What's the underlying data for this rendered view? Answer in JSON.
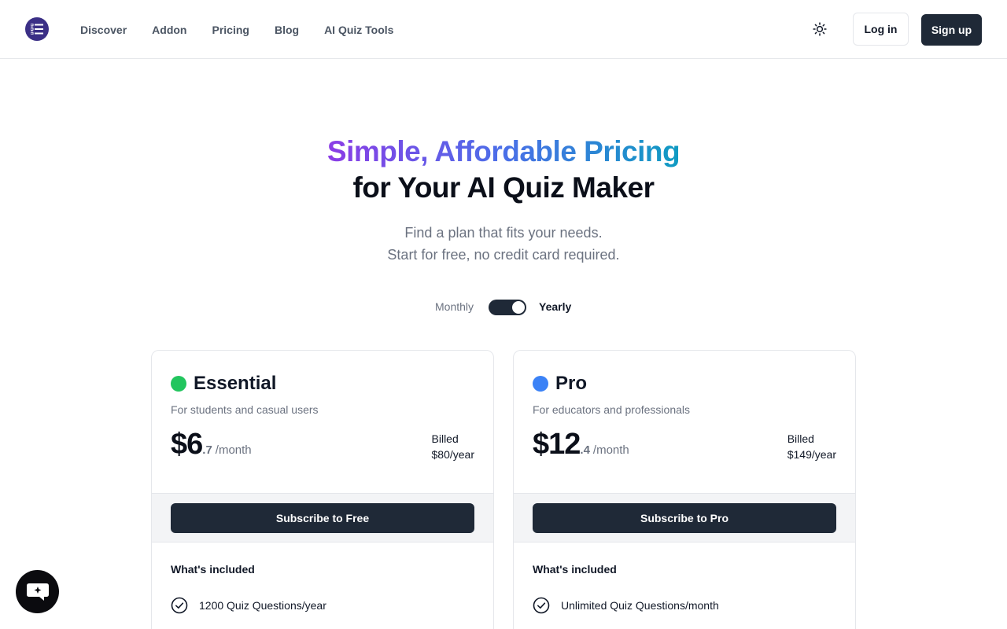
{
  "header": {
    "nav": [
      "Discover",
      "Addon",
      "Pricing",
      "Blog",
      "AI Quiz Tools"
    ],
    "login_label": "Log in",
    "signup_label": "Sign up",
    "theme_icon": "sun-icon",
    "logo_icon": "list-icon"
  },
  "hero": {
    "title_gradient": "Simple, Affordable Pricing",
    "title_dark": "for Your AI Quiz Maker",
    "subtitle_line1": "Find a plan that fits your needs.",
    "subtitle_line2": "Start for free, no credit card required."
  },
  "billing": {
    "monthly_label": "Monthly",
    "yearly_label": "Yearly",
    "selected": "Yearly"
  },
  "plans": [
    {
      "name": "Essential",
      "dot_color": "#22c55e",
      "description": "For students and casual users",
      "price_whole": "$6",
      "price_fraction": ".7",
      "period": "/month",
      "billed_line1": "Billed",
      "billed_line2": "$80/year",
      "button_label": "Subscribe to Free",
      "included_label": "What's included",
      "features": [
        "1200 Quiz Questions/year"
      ]
    },
    {
      "name": "Pro",
      "dot_color": "#3b82f6",
      "description": "For educators and professionals",
      "price_whole": "$12",
      "price_fraction": ".4",
      "period": "/month",
      "billed_line1": "Billed",
      "billed_line2": "$149/year",
      "button_label": "Subscribe to Pro",
      "included_label": "What's included",
      "features": [
        "Unlimited Quiz Questions/month"
      ]
    }
  ],
  "colors": {
    "primary_dark": "#1f2937",
    "logo_bg": "#3b2f86"
  },
  "chat_icon": "chat-bubble-icon"
}
